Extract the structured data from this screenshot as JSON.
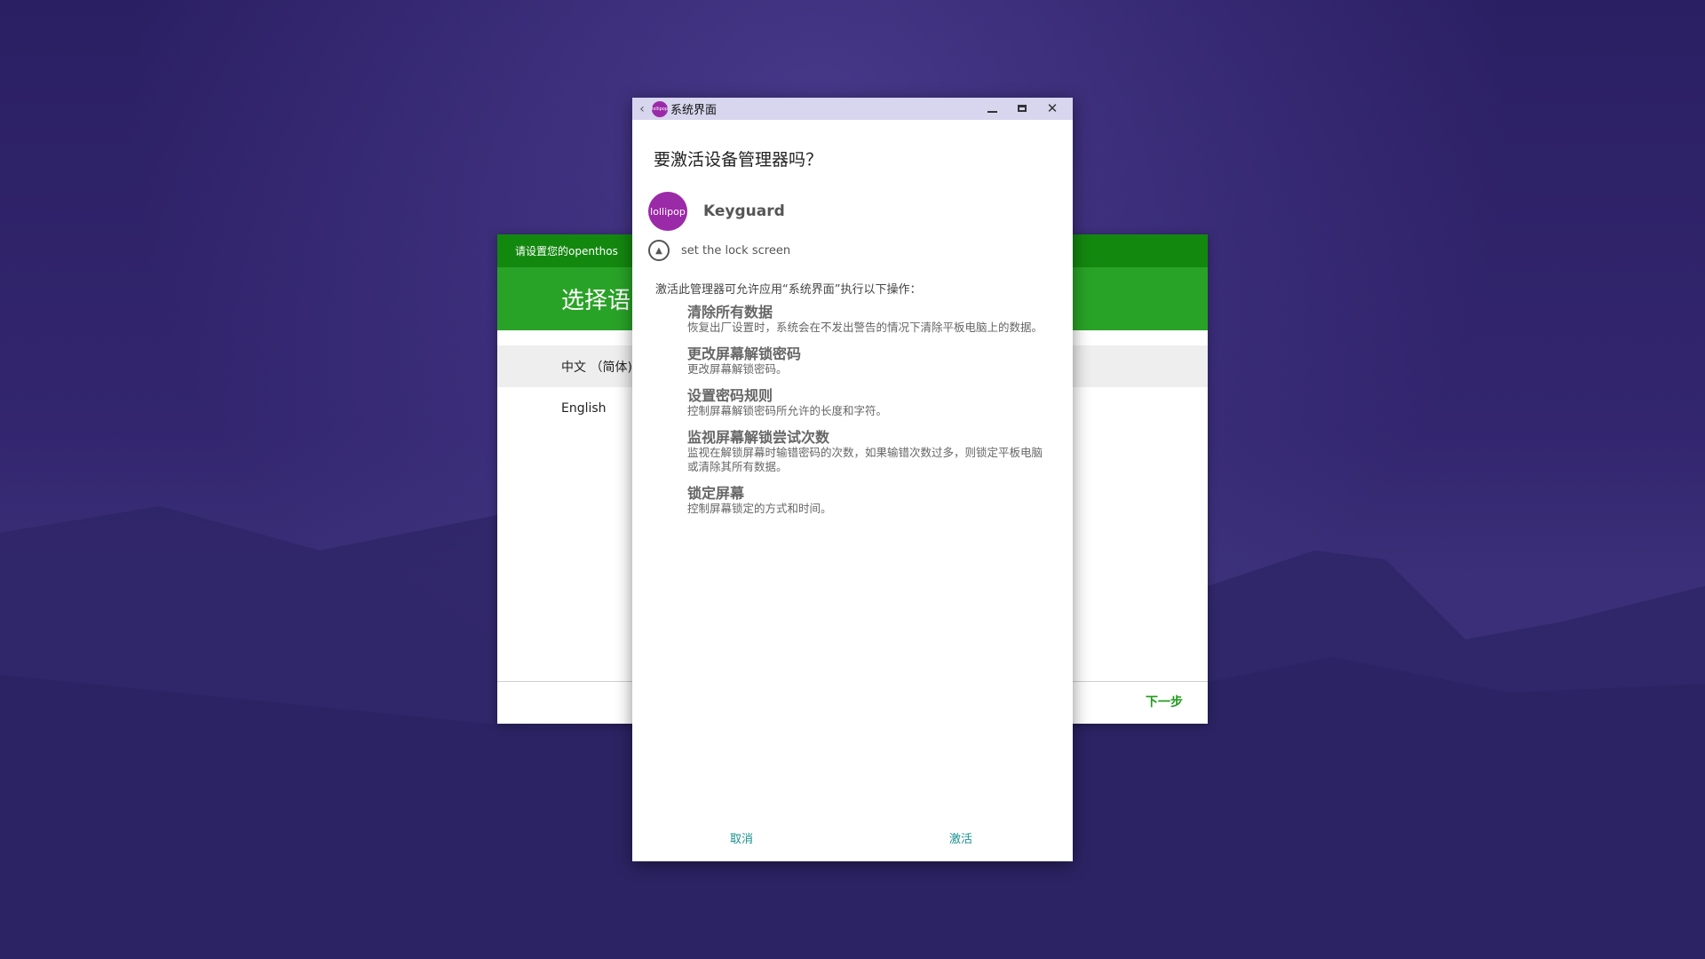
{
  "setup": {
    "topbar_title": "请设置您的openthos",
    "header_title": "选择语",
    "languages": [
      "中文 （简体)",
      "English"
    ],
    "next_label": "下一步"
  },
  "dialog": {
    "window_title": "系统界面",
    "app_icon_text": "lollipop",
    "title": "要激活设备管理器吗？",
    "app_name": "Keyguard",
    "description": "set the lock screen",
    "intro": "激活此管理器可允许应用“系统界面”执行以下操作：",
    "policies": [
      {
        "title": "清除所有数据",
        "desc": "恢复出厂设置时，系统会在不发出警告的情况下清除平板电脑上的数据。"
      },
      {
        "title": "更改屏幕解锁密码",
        "desc": "更改屏幕解锁密码。"
      },
      {
        "title": "设置密码规则",
        "desc": "控制屏幕解锁密码所允许的长度和字符。"
      },
      {
        "title": "监视屏幕解锁尝试次数",
        "desc": "监视在解锁屏幕时输错密码的次数，如果输错次数过多，则锁定平板电脑或清除其所有数据。"
      },
      {
        "title": "锁定屏幕",
        "desc": "控制屏幕锁定的方式和时间。"
      }
    ],
    "cancel_label": "取消",
    "activate_label": "激活"
  },
  "colors": {
    "setup_topbar": "#13880f",
    "setup_header": "#29a327",
    "dialog_titlebar": "#d7d6ee",
    "app_icon": "#9b2aa8",
    "dialog_button": "#1a8f8f"
  }
}
